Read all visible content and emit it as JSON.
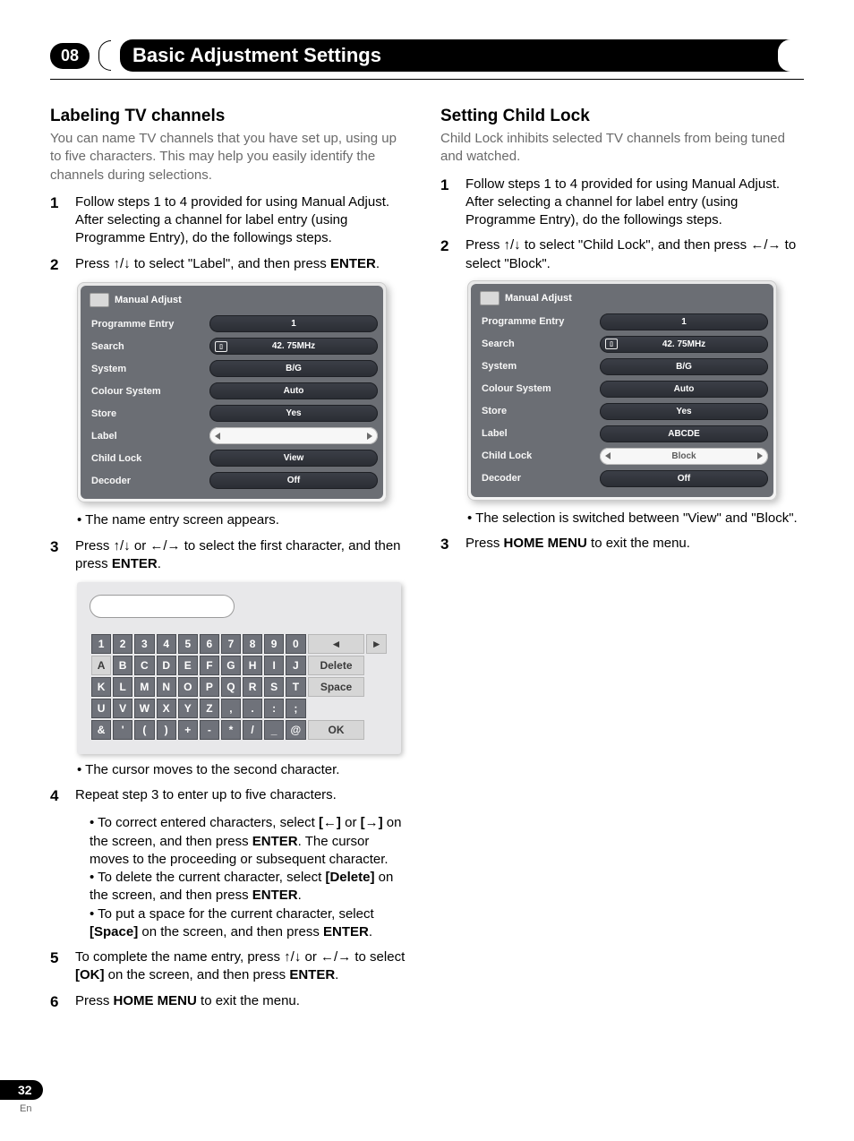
{
  "chapter": {
    "number": "08",
    "title": "Basic Adjustment Settings"
  },
  "page": {
    "number": "32",
    "lang": "En"
  },
  "left": {
    "heading": "Labeling TV channels",
    "lead": "You can name TV channels that you have set up, using up to five characters. This may help you easily identify the channels during selections.",
    "step1a": "Follow steps 1 to 4 provided for using Manual Adjust.",
    "step1b": "After selecting a channel for label entry (using Programme Entry), do the followings steps.",
    "step2_pre": "Press ",
    "step2_mid": " to select \"Label\", and then press ",
    "step2_enter": "ENTER",
    "step2_post": ".",
    "bullet_after_menu": "The name entry screen appears.",
    "step3_pre": "Press ",
    "step3_mid1": " or ",
    "step3_mid2": " to select the first character, and then press ",
    "step3_enter": "ENTER",
    "step3_post": ".",
    "bullet_after_kbd": "The cursor moves to the second character.",
    "step4": "Repeat step 3 to enter up to five characters.",
    "step4_b1_pre": "To correct entered characters, select ",
    "step4_b1_mid": " or ",
    "step4_b1_post1": " on the screen, and then press ",
    "step4_b1_enter": "ENTER",
    "step4_b1_post2": ". The cursor moves to the proceeding or subsequent character.",
    "step4_b2_pre": "To delete the current character, select ",
    "step4_b2_del": "[Delete]",
    "step4_b2_mid": " on the screen, and then press ",
    "step4_b2_enter": "ENTER",
    "step4_b2_post": ".",
    "step4_b3_pre": "To put a space for the current character, select ",
    "step4_b3_sp": "[Space]",
    "step4_b3_mid": " on the screen, and then press ",
    "step4_b3_enter": "ENTER",
    "step4_b3_post": ".",
    "step5_pre": "To complete the name entry, press ",
    "step5_mid1": " or ",
    "step5_mid2": " to select ",
    "step5_ok": "[OK]",
    "step5_mid3": " on the screen, and then press ",
    "step5_enter": "ENTER",
    "step5_post": ".",
    "step6_pre": "Press ",
    "step6_hm": "HOME MENU",
    "step6_post": " to exit the menu."
  },
  "right": {
    "heading": "Setting Child Lock",
    "lead": "Child Lock inhibits selected TV channels from being tuned and watched.",
    "step1a": "Follow steps 1 to 4 provided for using Manual Adjust.",
    "step1b": "After selecting a channel for label entry (using Programme Entry), do the followings steps.",
    "step2_pre": "Press ",
    "step2_mid1": " to select \"Child Lock\", and then press ",
    "step2_mid2": " to select \"Block\".",
    "bullet_after_menu": "The selection is switched between \"View\" and \"Block\".",
    "step3_pre": "Press ",
    "step3_hm": "HOME MENU",
    "step3_post": " to exit the menu."
  },
  "osd_left": {
    "title": "Manual Adjust",
    "rows": [
      {
        "label": "Programme Entry",
        "value": "1",
        "light": false
      },
      {
        "label": "Search",
        "value": "42. 75MHz",
        "light": false,
        "badge": true
      },
      {
        "label": "System",
        "value": "B/G",
        "light": false
      },
      {
        "label": "Colour System",
        "value": "Auto",
        "light": false
      },
      {
        "label": "Store",
        "value": "Yes",
        "light": false
      },
      {
        "label": "Label",
        "value": "",
        "light": true,
        "sel": true
      },
      {
        "label": "Child Lock",
        "value": "View",
        "light": false
      },
      {
        "label": "Decoder",
        "value": "Off",
        "light": false
      }
    ]
  },
  "osd_right": {
    "title": "Manual Adjust",
    "rows": [
      {
        "label": "Programme Entry",
        "value": "1",
        "light": false
      },
      {
        "label": "Search",
        "value": "42. 75MHz",
        "light": false,
        "badge": true
      },
      {
        "label": "System",
        "value": "B/G",
        "light": false
      },
      {
        "label": "Colour System",
        "value": "Auto",
        "light": false
      },
      {
        "label": "Store",
        "value": "Yes",
        "light": false
      },
      {
        "label": "Label",
        "value": "ABCDE",
        "light": false
      },
      {
        "label": "Child Lock",
        "value": "Block",
        "light": true,
        "sel": true
      },
      {
        "label": "Decoder",
        "value": "Off",
        "light": false
      }
    ]
  },
  "kbd": {
    "rows": [
      [
        "1",
        "2",
        "3",
        "4",
        "5",
        "6",
        "7",
        "8",
        "9",
        "0",
        "◄",
        "►"
      ],
      [
        "A",
        "B",
        "C",
        "D",
        "E",
        "F",
        "G",
        "H",
        "I",
        "J",
        "Delete"
      ],
      [
        "K",
        "L",
        "M",
        "N",
        "O",
        "P",
        "Q",
        "R",
        "S",
        "T",
        "Space"
      ],
      [
        "U",
        "V",
        "W",
        "X",
        "Y",
        "Z",
        ",",
        ".",
        ":",
        ";",
        ""
      ],
      [
        "&",
        "'",
        "(",
        ")",
        "+",
        "-",
        "*",
        "/",
        "_",
        "@",
        "OK"
      ]
    ]
  },
  "glyphs": {
    "updown": "↑/↓",
    "leftright": "←/→",
    "bracket_left": "[←]",
    "bracket_right": "[→]"
  }
}
